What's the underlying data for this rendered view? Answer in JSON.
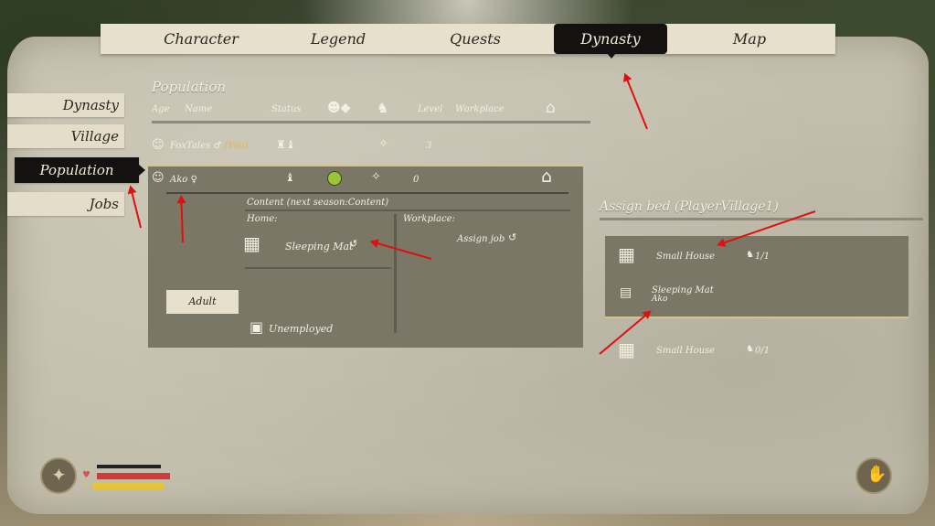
{
  "top_nav": {
    "tabs": [
      {
        "label": "Character"
      },
      {
        "label": "Legend"
      },
      {
        "label": "Quests"
      },
      {
        "label": "Dynasty",
        "active": true
      },
      {
        "label": "Map"
      }
    ]
  },
  "side_nav": {
    "items": [
      {
        "label": "Dynasty"
      },
      {
        "label": "Village"
      },
      {
        "label": "Population",
        "active": true
      },
      {
        "label": "Jobs"
      }
    ]
  },
  "population": {
    "title": "Population",
    "columns": {
      "age": "Age",
      "name": "Name",
      "status": "Status",
      "level": "Level",
      "workplace": "Workplace"
    },
    "villagers": [
      {
        "name": "FoxTales",
        "gender_symbol": "♂",
        "you_tag": "(You)",
        "level": "3"
      },
      {
        "name": "Ako",
        "gender_symbol": "♀",
        "level": "0"
      }
    ],
    "detail": {
      "content": "Content (next season:Content)",
      "home_label": "Home:",
      "home_value": "Sleeping Mat",
      "workplace_label": "Workplace:",
      "assign_job": "Assign job",
      "age_button": "Adult",
      "job_status": "Unemployed"
    }
  },
  "assign_bed": {
    "title": "Assign bed (PlayerVillage1)",
    "items": [
      {
        "name": "Small House",
        "count": "1/1"
      },
      {
        "name": "Sleeping Mat",
        "occupant": "Ako"
      },
      {
        "name": "Small House",
        "count": "0/1"
      }
    ]
  },
  "hud": {
    "health_fraction": 0.95,
    "stamina_fraction": 0.95
  },
  "colors": {
    "parchment": "#c4bfad",
    "active_tab": "#141210",
    "panel": "#7a7767",
    "highlight_line": "#d7c28a",
    "health": "#d23a3a",
    "stamina": "#e4c53a",
    "annotation_arrow": "#e01010"
  }
}
